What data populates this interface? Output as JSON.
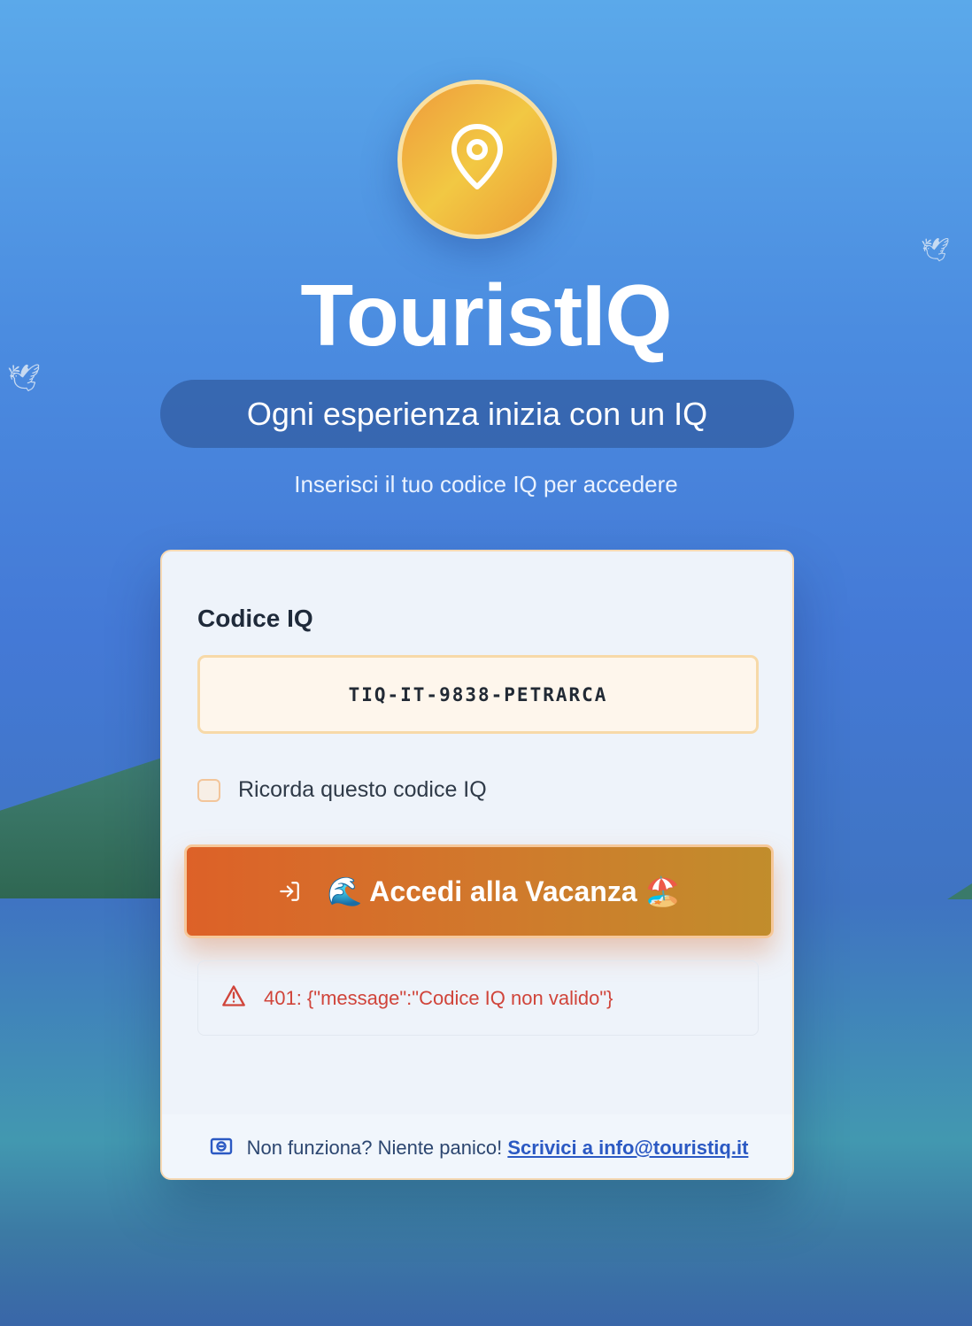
{
  "brand": {
    "name": "TouristIQ",
    "tagline": "Ogni esperienza inizia con un IQ",
    "subtitle": "Inserisci il tuo codice IQ per accedere"
  },
  "form": {
    "label": "Codice IQ",
    "code_value": "TIQ-IT-9838-PETRARCA",
    "remember_label": "Ricorda questo codice IQ",
    "submit_label": "🌊 Accedi alla Vacanza 🏖️"
  },
  "error": {
    "message": "401: {\"message\":\"Codice IQ non valido\"}"
  },
  "footer": {
    "text": "Non funziona? Niente panico!",
    "link_text": "Scrivici a info@touristiq.it"
  },
  "icons": {
    "logo": "map-pin-icon",
    "submit": "login-icon",
    "error": "warning-icon",
    "footer": "mail-icon",
    "decor": "dove-icon"
  },
  "colors": {
    "accent": "#dd6128",
    "error": "#d0443a",
    "link": "#2b59c3"
  }
}
